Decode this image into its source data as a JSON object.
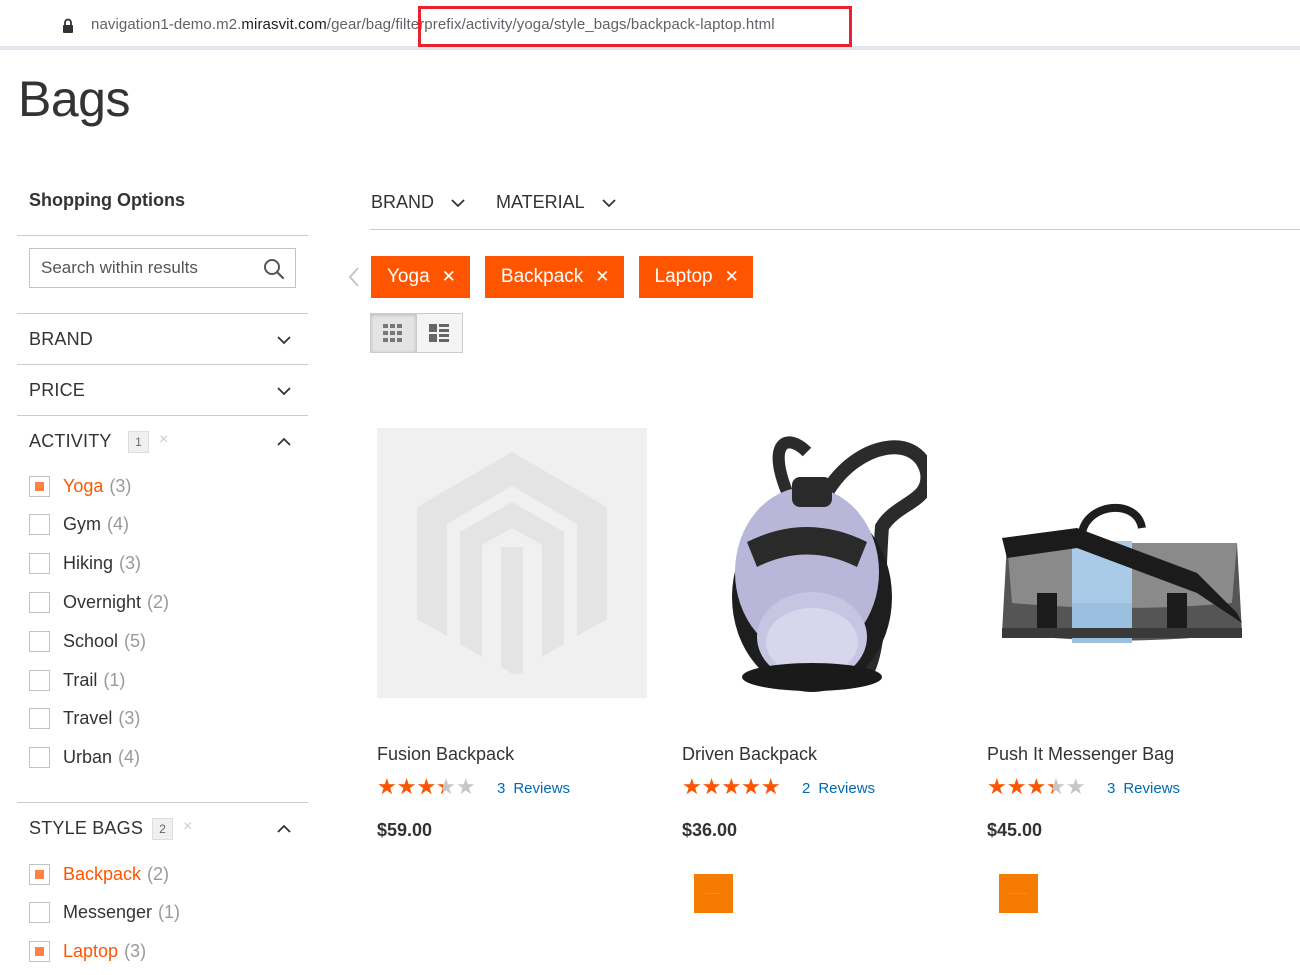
{
  "browser": {
    "url_prefix": "navigation1-demo.m2.",
    "url_domain": "mirasvit.com",
    "url_path_start": "/gear/bag",
    "url_path_highlight": "/filterprefix/activity/yoga/style_bags/backpack-laptop.html",
    "highlight_color": "#e8232d"
  },
  "page": {
    "title": "Bags"
  },
  "sidebar": {
    "title": "Shopping Options",
    "search": {
      "placeholder": "Search within results"
    },
    "facets": {
      "brand": {
        "label": "BRAND"
      },
      "price": {
        "label": "PRICE"
      },
      "activity": {
        "label": "ACTIVITY",
        "badge": "1",
        "clear": "×",
        "options": [
          {
            "label": "Yoga",
            "count": "(3)",
            "checked": true
          },
          {
            "label": "Gym",
            "count": "(4)",
            "checked": false
          },
          {
            "label": "Hiking",
            "count": "(3)",
            "checked": false
          },
          {
            "label": "Overnight",
            "count": "(2)",
            "checked": false
          },
          {
            "label": "School",
            "count": "(5)",
            "checked": false
          },
          {
            "label": "Trail",
            "count": "(1)",
            "checked": false
          },
          {
            "label": "Travel",
            "count": "(3)",
            "checked": false
          },
          {
            "label": "Urban",
            "count": "(4)",
            "checked": false
          }
        ]
      },
      "style_bags": {
        "label": "STYLE BAGS",
        "badge": "2",
        "clear": "×",
        "options": [
          {
            "label": "Backpack",
            "count": "(2)",
            "checked": true
          },
          {
            "label": "Messenger",
            "count": "(1)",
            "checked": false
          },
          {
            "label": "Laptop",
            "count": "(3)",
            "checked": true
          }
        ]
      }
    }
  },
  "top_filters": [
    {
      "label": "BRAND"
    },
    {
      "label": "MATERIAL"
    }
  ],
  "active_filters": [
    {
      "label": "Yoga"
    },
    {
      "label": "Backpack"
    },
    {
      "label": "Laptop"
    }
  ],
  "accent_color": "#ff5501",
  "products": [
    {
      "name": "Fusion Backpack",
      "rating": 0.6,
      "review_count": "3",
      "review_label": "Reviews",
      "price": "$59.00",
      "image": "placeholder-logo",
      "swatch": false
    },
    {
      "name": "Driven Backpack",
      "rating": 0.9,
      "review_count": "2",
      "review_label": "Reviews",
      "price": "$36.00",
      "image": "backpack",
      "swatch": true
    },
    {
      "name": "Push It Messenger Bag",
      "rating": 0.6,
      "review_count": "3",
      "review_label": "Reviews",
      "price": "$45.00",
      "image": "messenger-bag",
      "swatch": true
    }
  ]
}
